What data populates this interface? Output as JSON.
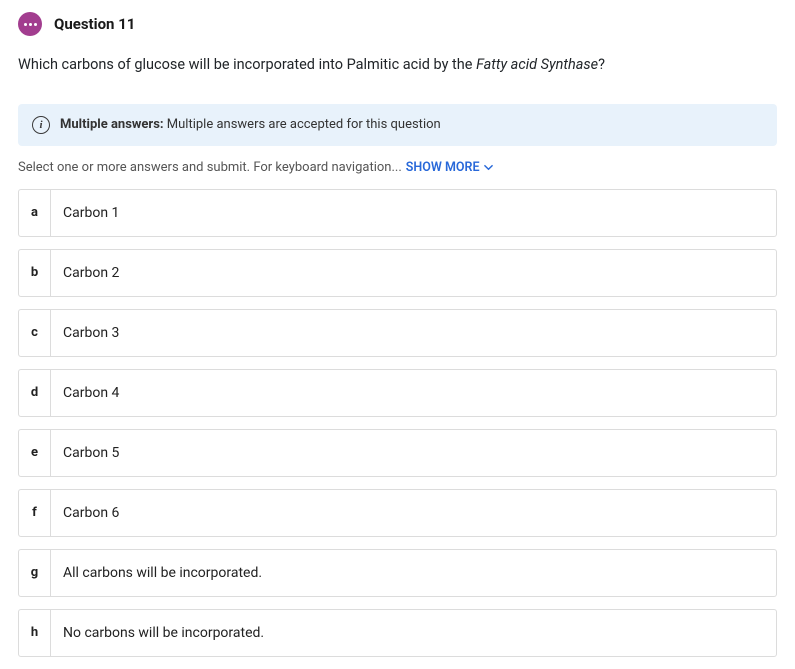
{
  "header": {
    "title": "Question 11"
  },
  "question": {
    "text_before": "Which carbons of glucose will be incorporated into Palmitic acid by the ",
    "italic": "Fatty acid Synthase",
    "text_after": "?"
  },
  "banner": {
    "bold": "Multiple answers:",
    "rest": "  Multiple answers are accepted for this question"
  },
  "instructions": {
    "text": "Select one or more answers and submit. For keyboard navigation...",
    "show_more": "SHOW MORE"
  },
  "answers": [
    {
      "key": "a",
      "text": "Carbon 1"
    },
    {
      "key": "b",
      "text": "Carbon 2"
    },
    {
      "key": "c",
      "text": "Carbon 3"
    },
    {
      "key": "d",
      "text": "Carbon 4"
    },
    {
      "key": "e",
      "text": "Carbon 5"
    },
    {
      "key": "f",
      "text": "Carbon 6"
    },
    {
      "key": "g",
      "text": "All carbons will be incorporated."
    },
    {
      "key": "h",
      "text": "No carbons will be incorporated."
    }
  ]
}
